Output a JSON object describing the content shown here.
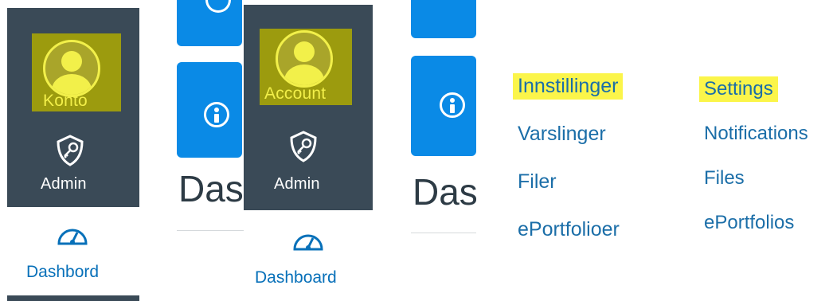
{
  "panel_norwegian": {
    "account_label": "Konto",
    "admin_label": "Admin",
    "dash_fragment": "Das",
    "dashboard_label": "Dashbord"
  },
  "panel_english": {
    "account_label": "Account",
    "admin_label": "Admin",
    "dash_fragment": "Das",
    "dashboard_label": "Dashboard"
  },
  "menu_norwegian": {
    "items": [
      "Innstillinger",
      "Varslinger",
      "Filer",
      "ePortfolioer"
    ]
  },
  "menu_english": {
    "items": [
      "Settings",
      "Notifications",
      "Files",
      "ePortfolios"
    ]
  },
  "colors": {
    "sidebar": "#3a4a57",
    "tile": "#0a8ae6",
    "highlight_yellow": "#fbf54a",
    "link_blue": "#1b6ea8"
  },
  "icons": [
    "avatar-icon",
    "admin-shield-key-icon",
    "info-icon",
    "dashboard-speedometer-icon"
  ]
}
